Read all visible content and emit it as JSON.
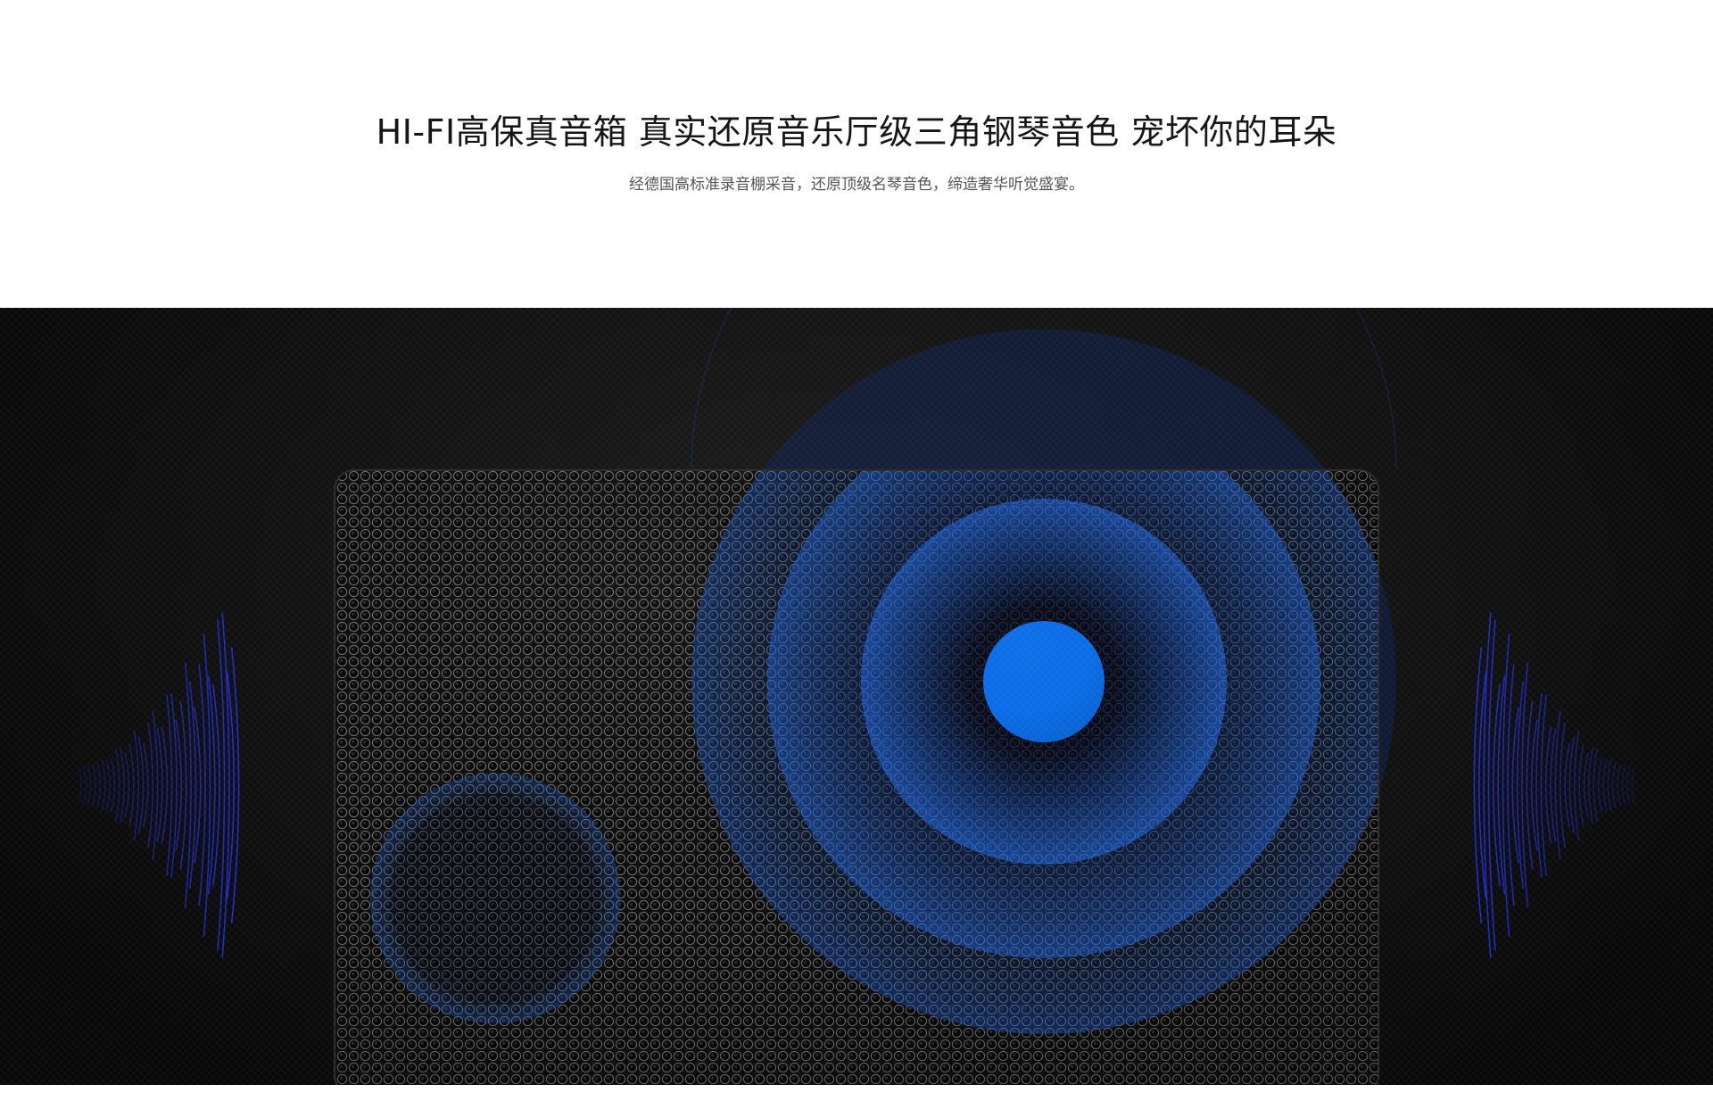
{
  "hero": {
    "headline": "HI-FI高保真音箱  真实还原音乐厅级三角钢琴音色  宠坏你的耳朵",
    "subline": "经德国高标准录音棚采音，还原顶级名琴音色，缔造奢华听觉盛宴。"
  },
  "visual": {
    "accent_color": "#0a6de8",
    "wave_color": "#1f2fd6",
    "background_color": "#121212",
    "grille_color": "#3a3a3a",
    "icons": [
      "speaker-grille",
      "woofer-ring",
      "tweeter-dot",
      "sound-wave-left",
      "sound-wave-right"
    ]
  }
}
